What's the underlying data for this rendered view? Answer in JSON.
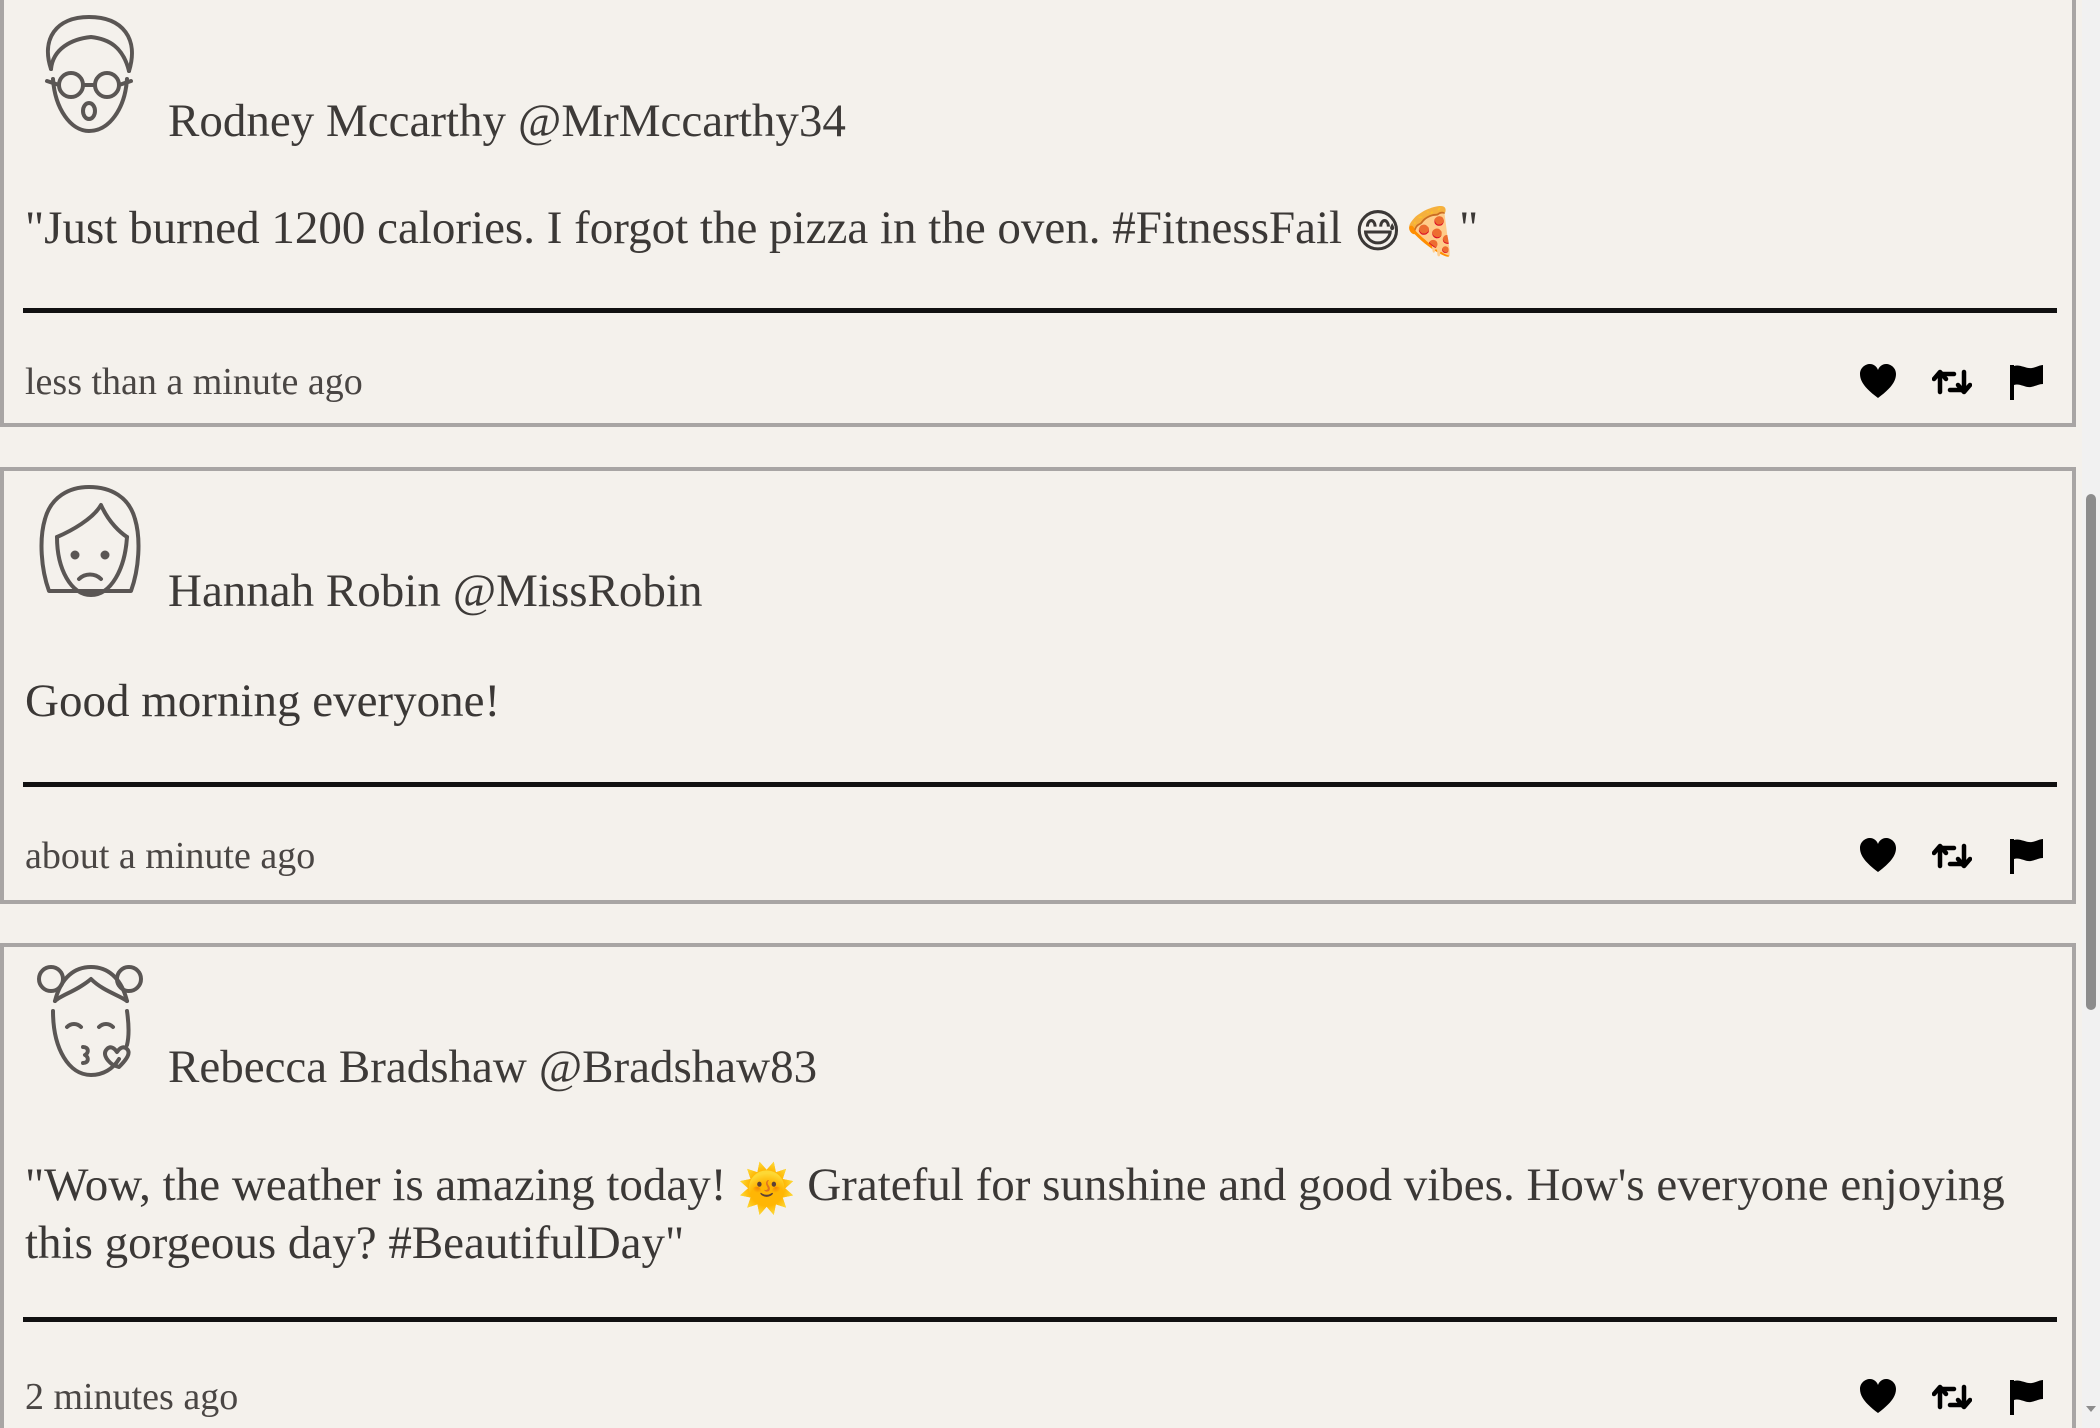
{
  "feed": {
    "tweets": [
      {
        "name": "Rodney Mccarthy",
        "handle": "@MrMccarthy34",
        "text_before": "\"Just burned 1200 calories. I forgot the pizza in the oven. #FitnessFail ",
        "emoji_1": "😅",
        "emoji_2": "🍕",
        "text_after": "\"",
        "timestamp": "less than a minute ago",
        "avatar_icon": "man-glasses-avatar-icon"
      },
      {
        "name": "Hannah Robin",
        "handle": "@MissRobin",
        "text": "Good morning everyone!",
        "timestamp": "about a minute ago",
        "avatar_icon": "woman-sad-avatar-icon"
      },
      {
        "name": "Rebecca Bradshaw",
        "handle": "@Bradshaw83",
        "text_before": "\"Wow, the weather is amazing today! ",
        "emoji_1": "🌞",
        "text_after": " Grateful for sunshine and good vibes. How's everyone enjoying this gorgeous day? #BeautifulDay\"",
        "timestamp": "2 minutes ago",
        "avatar_icon": "girl-kiss-avatar-icon"
      }
    ]
  },
  "actions": {
    "like_icon": "heart-icon",
    "retweet_icon": "retweet-icon",
    "report_icon": "flag-icon"
  },
  "colors": {
    "background": "#f4f1ec",
    "card_border": "#a8a5a4",
    "text": "#3b3836",
    "divider": "#111111",
    "icon": "#000000"
  }
}
